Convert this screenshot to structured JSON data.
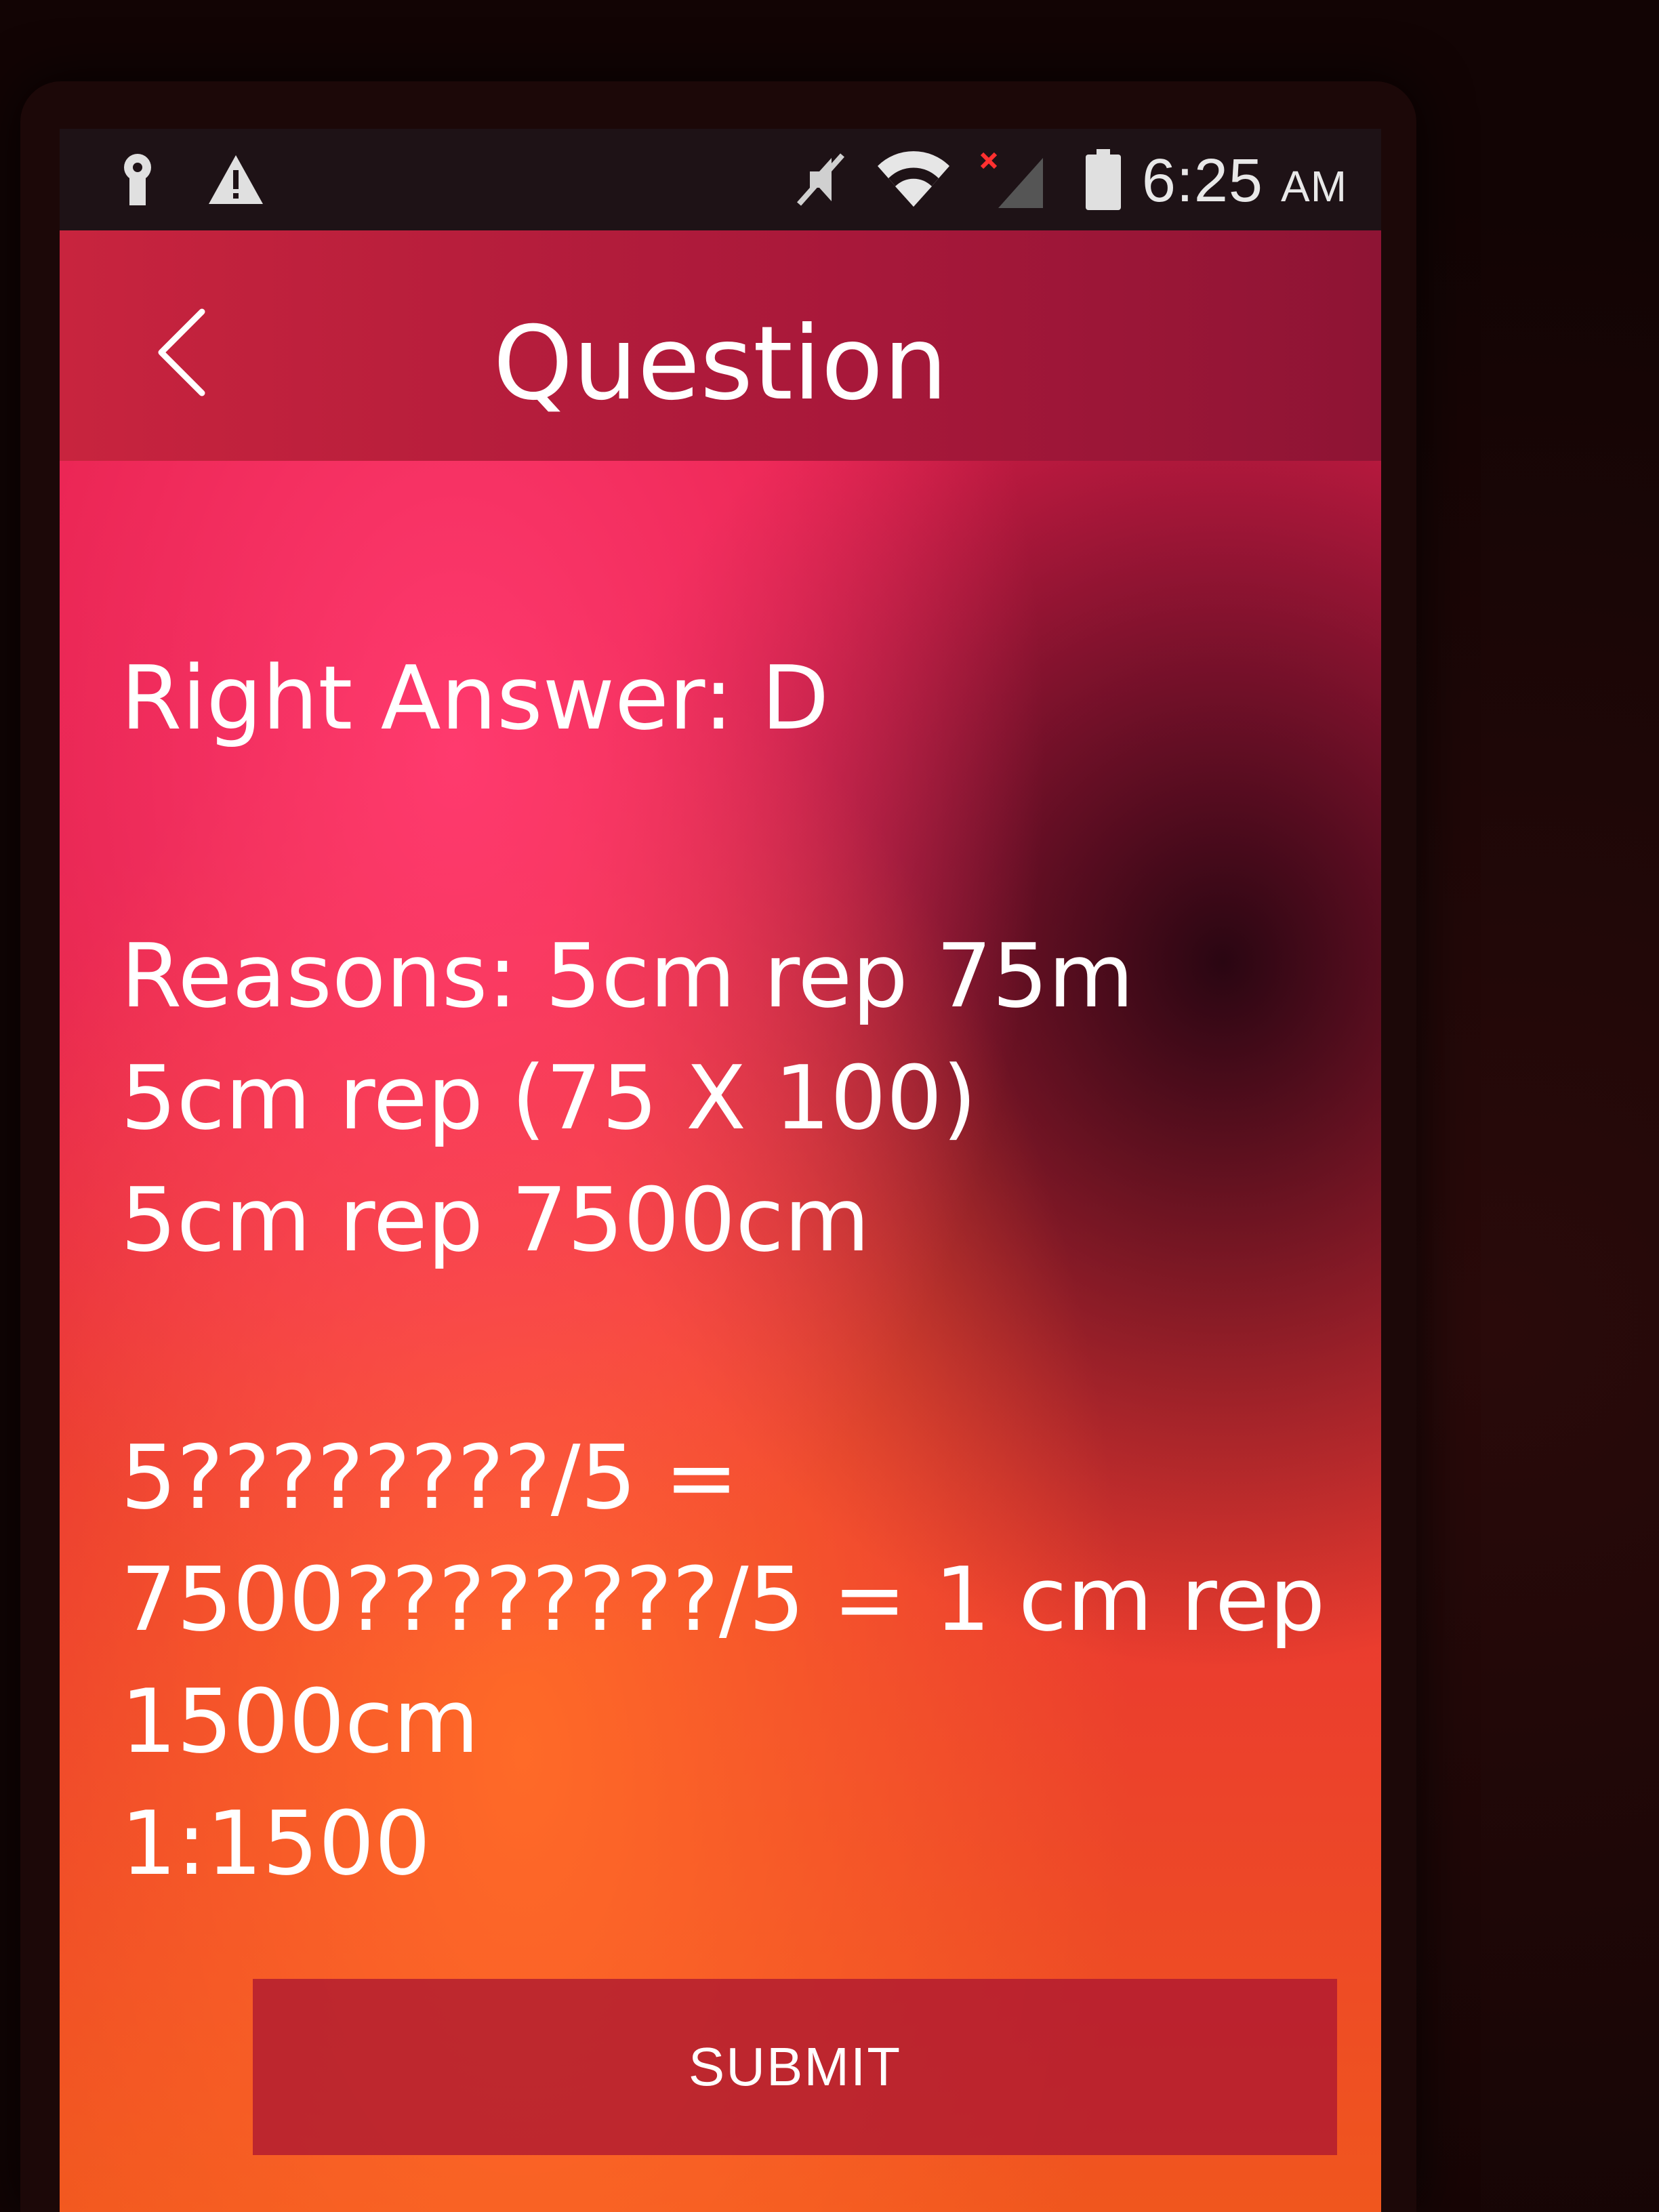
{
  "status_bar": {
    "time": "6:25",
    "ampm": "AM",
    "icons": [
      "keyhole-icon",
      "warning-icon",
      "mute-icon",
      "wifi-icon",
      "no-signal-icon",
      "battery-icon"
    ]
  },
  "app_bar": {
    "title": "Question",
    "back_icon": "chevron-left-icon"
  },
  "content": {
    "right_answer_label": "Right Answer:",
    "right_answer_value": "D",
    "reasons_lines": [
      "Reasons:  5cm rep 75m",
      "5cm rep (75 X 100)",
      "5cm rep 7500cm",
      "",
      "5????????/5 =",
      "7500????????/5 = 1 cm rep",
      "1500cm",
      "1:1500"
    ]
  },
  "actions": {
    "submit_label": "SUBMIT"
  },
  "colors": {
    "status_bar_bg": "#1e1216",
    "app_bar_bg": "#b01c3c",
    "content_gradient_top": "#e81e4e",
    "content_gradient_bottom": "#f0561e",
    "submit_bg": "#a81432"
  }
}
